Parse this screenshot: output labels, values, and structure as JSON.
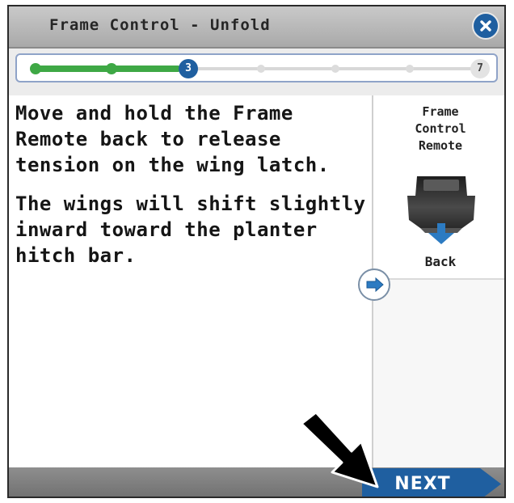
{
  "dialog": {
    "title": "Frame Control - Unfold",
    "close_icon": "close-x-icon"
  },
  "progress": {
    "current_step": "3",
    "total_steps": "7",
    "completed_fraction": 0.33,
    "complete_color": "#3ea845",
    "current_color": "#1f5fa0"
  },
  "instructions": {
    "paragraph1": "Move and hold the Frame Remote back to release tension on the wing latch.",
    "paragraph2": "The wings will shift slightly inward toward the planter hitch bar."
  },
  "side_panel": {
    "title": "Frame\nControl\nRemote",
    "remote_icon": "frame-remote-icon",
    "direction_icon": "arrow-down-icon",
    "direction_label": "Back",
    "scroll_icon": "arrow-right-icon"
  },
  "footer": {
    "next_label": "NEXT",
    "accent_color": "#1f5fa0"
  },
  "annotation": {
    "pointer_icon": "black-arrow-pointer-icon"
  }
}
